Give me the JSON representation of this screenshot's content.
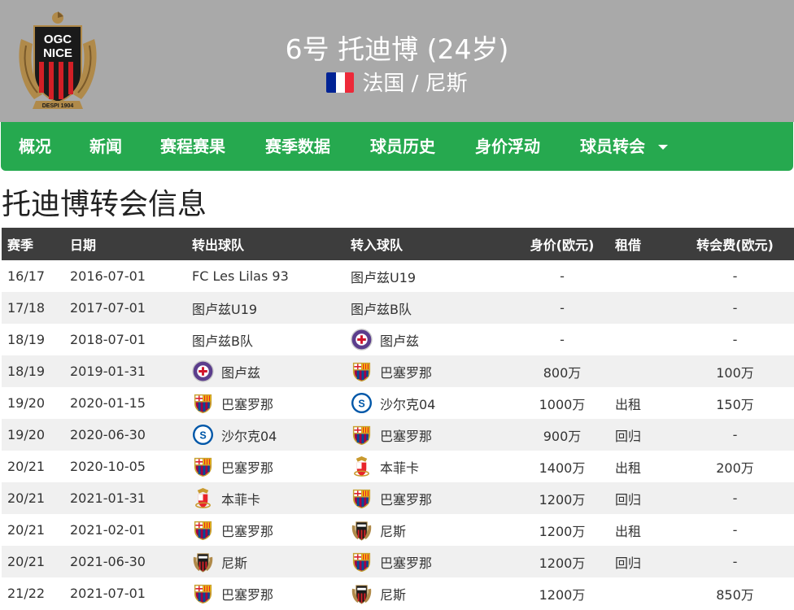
{
  "header": {
    "player_name": "6号 托迪博 (24岁)",
    "country": "法国 / 尼斯",
    "background_color": "#a9a9a9",
    "logo": {
      "text_line1": "OGC",
      "text_line2": "NICE",
      "motto": "DESPI 1904",
      "icon": "ogc-nice-crest-icon"
    },
    "flag_icon": "france-flag-icon",
    "flag_colors": [
      "#002395",
      "#ffffff",
      "#ed2939"
    ]
  },
  "nav": {
    "color": "#26a94f",
    "items": [
      {
        "label": "概况"
      },
      {
        "label": "新闻"
      },
      {
        "label": "赛程赛果"
      },
      {
        "label": "赛季数据"
      },
      {
        "label": "球员历史"
      },
      {
        "label": "身价浮动"
      },
      {
        "label": "球员转会"
      }
    ]
  },
  "page_title": "托迪博转会信息",
  "table": {
    "header_color": "#3d3d3d",
    "columns": [
      "赛季",
      "日期",
      "转出球队",
      "转入球队",
      "身价(欧元)",
      "租借",
      "转会费(欧元)"
    ],
    "rows": [
      {
        "season": "16/17",
        "date": "2016-07-01",
        "from": "FC Les Lilas 93",
        "from_icon": "",
        "to": "图卢兹U19",
        "to_icon": "",
        "value": "-",
        "loan": "",
        "fee": "-"
      },
      {
        "season": "17/18",
        "date": "2017-07-01",
        "from": "图卢兹U19",
        "from_icon": "",
        "to": "图卢兹B队",
        "to_icon": "",
        "value": "-",
        "loan": "",
        "fee": "-"
      },
      {
        "season": "18/19",
        "date": "2018-07-01",
        "from": "图卢兹B队",
        "from_icon": "",
        "to": "图卢兹",
        "to_icon": "toulouse-crest-icon",
        "value": "-",
        "loan": "",
        "fee": "-"
      },
      {
        "season": "18/19",
        "date": "2019-01-31",
        "from": "图卢兹",
        "from_icon": "toulouse-crest-icon",
        "to": "巴塞罗那",
        "to_icon": "barcelona-crest-icon",
        "value": "800万",
        "loan": "",
        "fee": "100万"
      },
      {
        "season": "19/20",
        "date": "2020-01-15",
        "from": "巴塞罗那",
        "from_icon": "barcelona-crest-icon",
        "to": "沙尔克04",
        "to_icon": "schalke-crest-icon",
        "value": "1000万",
        "loan": "出租",
        "fee": "150万"
      },
      {
        "season": "19/20",
        "date": "2020-06-30",
        "from": "沙尔克04",
        "from_icon": "schalke-crest-icon",
        "to": "巴塞罗那",
        "to_icon": "barcelona-crest-icon",
        "value": "900万",
        "loan": "回归",
        "fee": "-"
      },
      {
        "season": "20/21",
        "date": "2020-10-05",
        "from": "巴塞罗那",
        "from_icon": "barcelona-crest-icon",
        "to": "本菲卡",
        "to_icon": "benfica-crest-icon",
        "value": "1400万",
        "loan": "出租",
        "fee": "200万"
      },
      {
        "season": "20/21",
        "date": "2021-01-31",
        "from": "本菲卡",
        "from_icon": "benfica-crest-icon",
        "to": "巴塞罗那",
        "to_icon": "barcelona-crest-icon",
        "value": "1200万",
        "loan": "回归",
        "fee": "-"
      },
      {
        "season": "20/21",
        "date": "2021-02-01",
        "from": "巴塞罗那",
        "from_icon": "barcelona-crest-icon",
        "to": "尼斯",
        "to_icon": "nice-crest-icon",
        "value": "1200万",
        "loan": "出租",
        "fee": "-"
      },
      {
        "season": "20/21",
        "date": "2021-06-30",
        "from": "尼斯",
        "from_icon": "nice-crest-icon",
        "to": "巴塞罗那",
        "to_icon": "barcelona-crest-icon",
        "value": "1200万",
        "loan": "回归",
        "fee": "-"
      },
      {
        "season": "21/22",
        "date": "2021-07-01",
        "from": "巴塞罗那",
        "from_icon": "barcelona-crest-icon",
        "to": "尼斯",
        "to_icon": "nice-crest-icon",
        "value": "1200万",
        "loan": "",
        "fee": "850万"
      }
    ]
  }
}
